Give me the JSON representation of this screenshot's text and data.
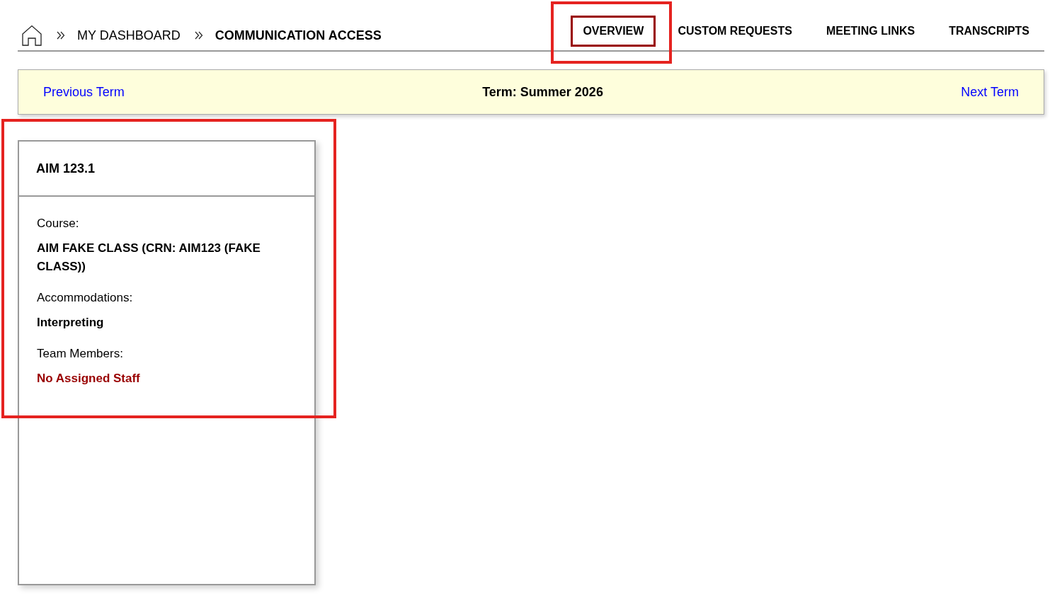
{
  "breadcrumb": [
    {
      "label": "MY DASHBOARD",
      "current": false
    },
    {
      "label": "COMMUNICATION ACCESS",
      "current": true
    }
  ],
  "tabs": [
    {
      "label": "OVERVIEW",
      "selected": true,
      "highlighted": true
    },
    {
      "label": "CUSTOM REQUESTS",
      "selected": false,
      "highlighted": false
    },
    {
      "label": "MEETING LINKS",
      "selected": false,
      "highlighted": false
    },
    {
      "label": "TRANSCRIPTS",
      "selected": false,
      "highlighted": false
    }
  ],
  "term_bar": {
    "previous": "Previous Term",
    "term": "Term: Summer 2026",
    "next": "Next Term"
  },
  "cards": [
    {
      "title": "AIM 123.1",
      "highlighted": true,
      "fields": [
        {
          "label": "Course:",
          "value": "AIM FAKE CLASS (CRN: AIM123 (FAKE CLASS))",
          "kind": "info"
        },
        {
          "label": "Accommodations:",
          "value": "Interpreting",
          "kind": "info"
        },
        {
          "label": "Team Members:",
          "value": "No Assigned Staff",
          "kind": "alert"
        }
      ]
    }
  ]
}
